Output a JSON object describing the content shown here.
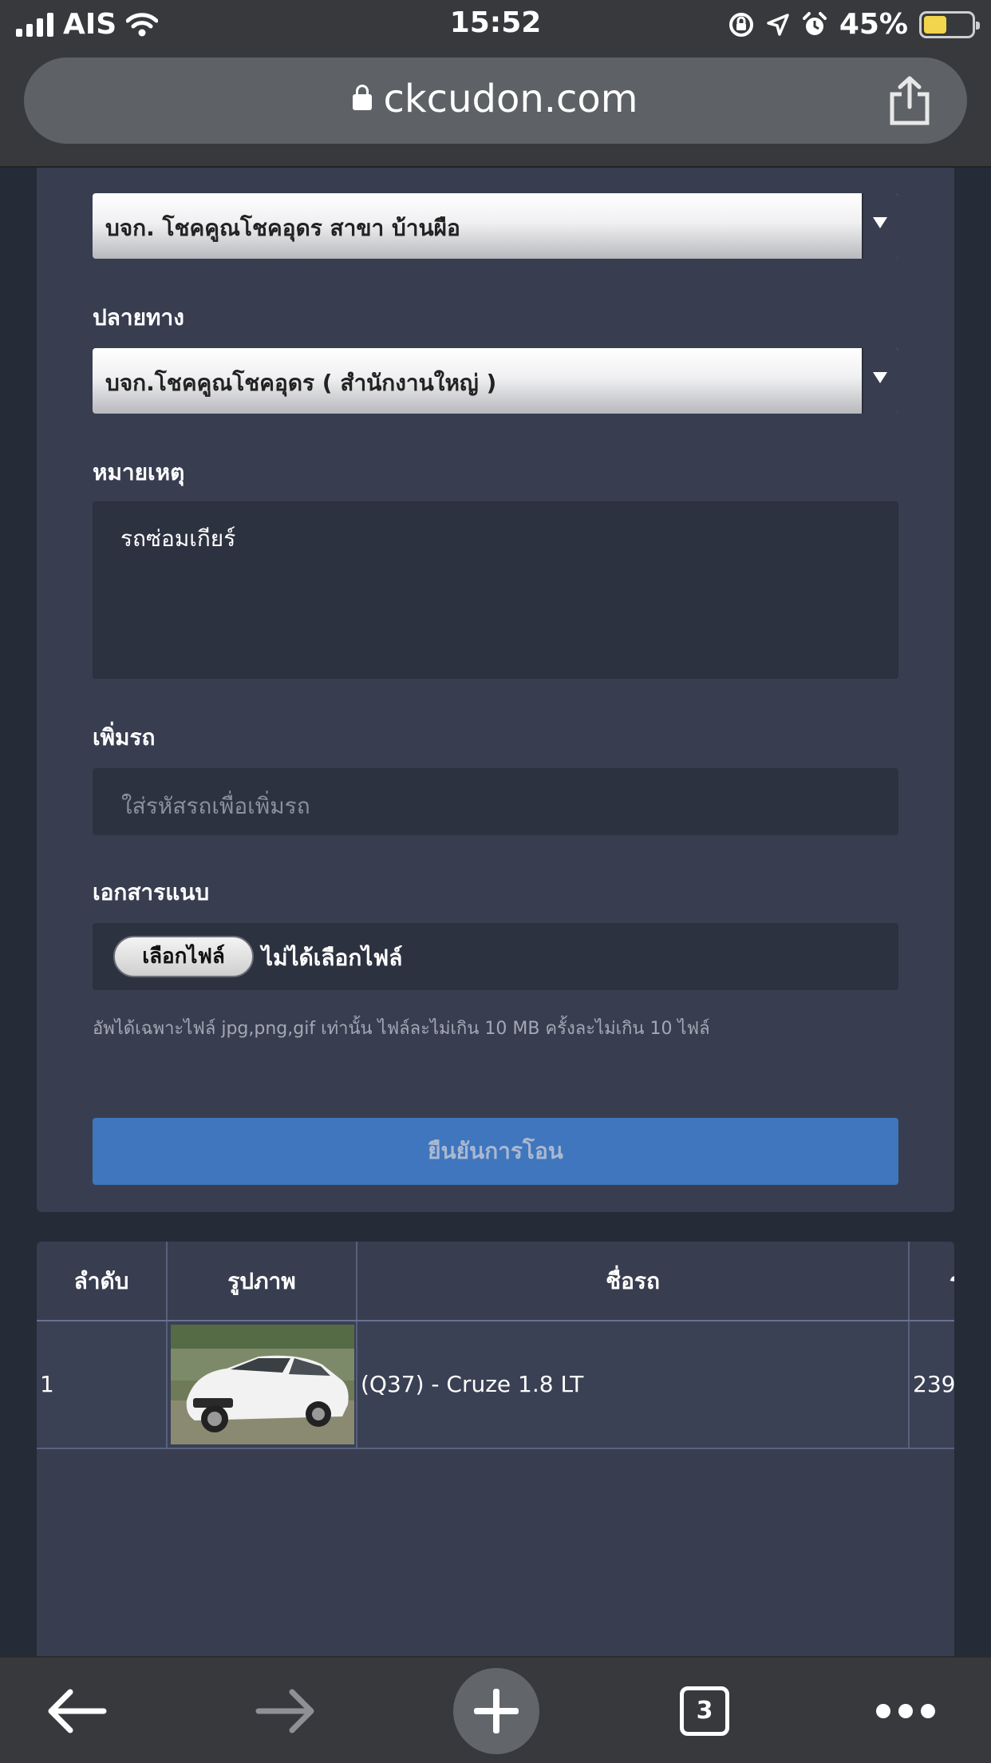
{
  "status_bar": {
    "carrier": "AIS",
    "time": "15:52",
    "battery_percent": "45%",
    "battery_level": 0.45,
    "icons": [
      "signal-icon",
      "wifi-icon",
      "rotation-lock-icon",
      "location-icon",
      "alarm-icon",
      "battery-icon"
    ]
  },
  "browser": {
    "url": "ckcudon.com",
    "share_icon": "share-icon"
  },
  "form": {
    "origin_select_value": "บจก. โชคคูณโชคอุดร สาขา บ้านผือ",
    "destination_label": "ปลายทาง",
    "destination_select_value": "บจก.โชคคูณโชคอุดร ( สำนักงานใหญ่ )",
    "note_label": "หมายเหตุ",
    "note_value": "รถซ่อมเกียร์",
    "add_car_label": "เพิ่มรถ",
    "add_car_placeholder": "ใส่รหัสรถเพื่อเพิ่มรถ",
    "attachment_label": "เอกสารแนบ",
    "choose_file_button": "เลือกไฟล์",
    "file_status": "ไม่ได้เลือกไฟล์",
    "upload_hint": "อัพได้เฉพาะไฟล์ jpg,png,gif เท่านั้น ไฟล์ละไม่เกิน 10 MB ครั้งละไม่เกิน 10 ไฟล์",
    "submit_button": "ยืนยันการโอน"
  },
  "table": {
    "columns": [
      "ลำดับ",
      "รูปภาพ",
      "ชื่อรถ",
      "ร"
    ],
    "rows": [
      {
        "index": "1",
        "image": "car-photo",
        "name": "(Q37) - Cruze 1.8 LT",
        "extra": "239"
      }
    ]
  },
  "toolbar": {
    "tab_count": "3",
    "icons": [
      "back-arrow-icon",
      "forward-arrow-icon",
      "new-tab-icon",
      "tabs-icon",
      "more-icon"
    ]
  }
}
